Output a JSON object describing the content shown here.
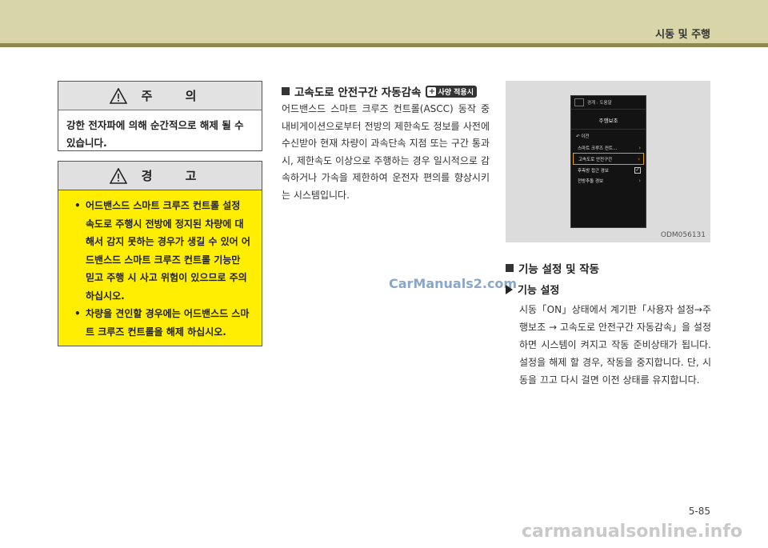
{
  "header": {
    "title": "시동 및 주행"
  },
  "caution": {
    "title": "주 의",
    "body": "강한 전자파에 의해 순간적으로 해제 될 수 있습니다."
  },
  "warning": {
    "title": "경 고",
    "items": [
      "어드밴스드 스마트 크루즈 컨트롤 설정 속도로 주행시 전방에 정지된 차량에 대해서 감지 못하는 경우가 생길 수 있어 어드밴스드 스마트 크루즈 컨트롤 기능만 믿고 주행 시 사고 위험이 있으므로 주의 하십시오.",
      "차량을 견인할 경우에는 어드밴스드 스마트 크루즈 컨트롤을 해제 하십시오."
    ]
  },
  "section": {
    "title": "고속도로 안전구간 자동감속",
    "badge": "사양 적용시",
    "intro": "어드밴스드 스마트 크루즈 컨트롤(ASCC) 동작 중 내비게이션으로부터 전방의 제한속도 정보를 사전에 수신받아 현재 차량이 과속단속 지점 또는 구간 통과 시, 제한속도 이상으로 주행하는 경우 일시적으로 감속하거나 가속을 제한하여 운전자 편의를 향상시키는 시스템입니다."
  },
  "screen": {
    "top_label": "경계 : 도움말",
    "title": "주행보조",
    "back": "이전",
    "items": [
      {
        "label": "스마트 크루즈 컨트...",
        "control": "chevron"
      },
      {
        "label": "고속도로 안전구간",
        "control": "chevron",
        "selected": true
      },
      {
        "label": "후측방 접근 경보",
        "control": "checkbox"
      },
      {
        "label": "전방추돌 경보",
        "control": "chevron"
      }
    ],
    "image_code": "ODM056131"
  },
  "function_section": {
    "title": "기능 설정 및 작동",
    "subtitle": "기능 설정",
    "text": "시동「ON」상태에서 계기판「사용자 설정→주행보조 → 고속도로 안전구간 자동감속」을 설정하면 시스템이 켜지고 작동 준비상태가 됩니다. 설정을 해제 할 경우, 작동을 중지합니다. 단, 시동을 끄고 다시 걸면 이전 상태를 유지합니다."
  },
  "watermark": "CarManuals2.com",
  "page_number": "5-85",
  "footer_watermark": "carmanualsonline.info"
}
